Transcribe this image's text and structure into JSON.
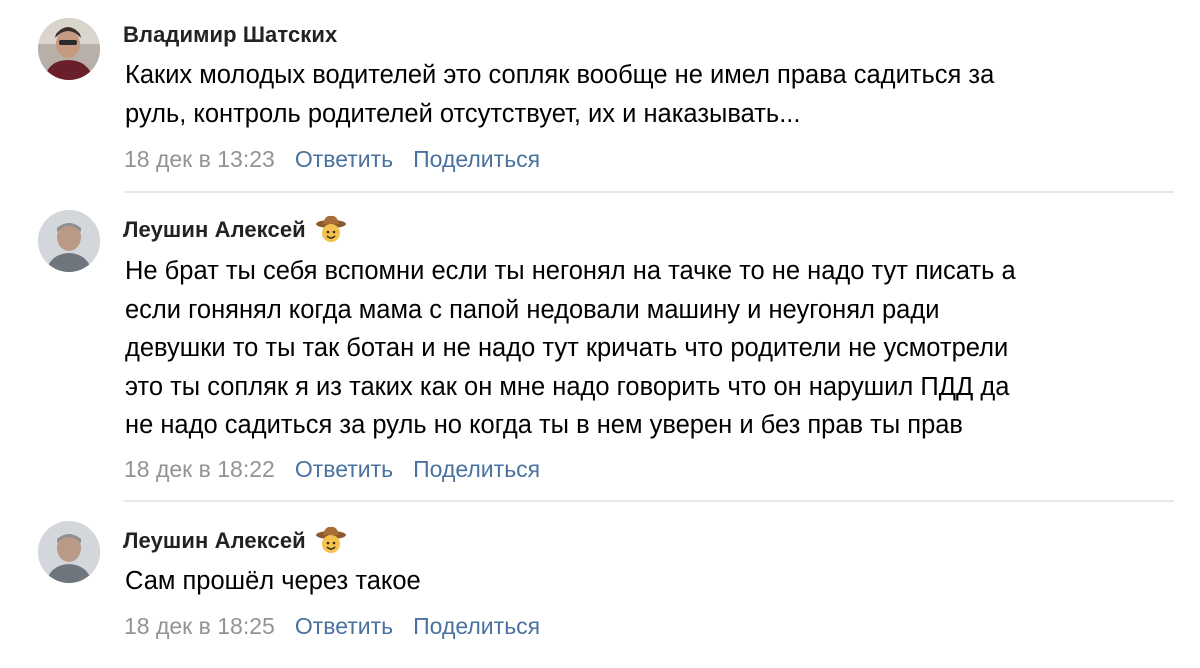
{
  "comments": [
    {
      "author": "Владимир Шатских",
      "has_badge": false,
      "text_lines": [
        "Каких молодых водителей это сопляк вообще не имел права садиться за",
        "руль, контроль родителей отсутствует, их и наказывать..."
      ],
      "date": "18 дек в 13:23",
      "reply_label": "Ответить",
      "share_label": "Поделиться"
    },
    {
      "author": "Леушин Алексей",
      "has_badge": true,
      "text_lines": [
        "Не брат ты себя вспомни если ты негонял на тачке то не надо тут писать а",
        "если гонянял когда мама с папой недовали машину и неугонял ради",
        "девушки то ты так ботан и не надо тут кричать что родители не усмотрели",
        "это ты сопляк я из таких как он мне надо говорить что он нарушил ПДД да",
        "не надо садиться за руль но когда ты в нем уверен и без прав ты прав"
      ],
      "date": "18 дек в 18:22",
      "reply_label": "Ответить",
      "share_label": "Поделиться"
    },
    {
      "author": "Леушин Алексей",
      "has_badge": true,
      "text_lines": [
        "Сам прошёл через такое"
      ],
      "date": "18 дек в 18:25",
      "reply_label": "Ответить",
      "share_label": "Поделиться"
    }
  ],
  "icons": {
    "avatar": "user-photo",
    "badge": "cowboy-hat-emoji-icon"
  },
  "colors": {
    "author": "#222222",
    "text": "#000000",
    "date": "#939393",
    "action_link": "#4a72a0",
    "divider": "#e7e8ec"
  }
}
